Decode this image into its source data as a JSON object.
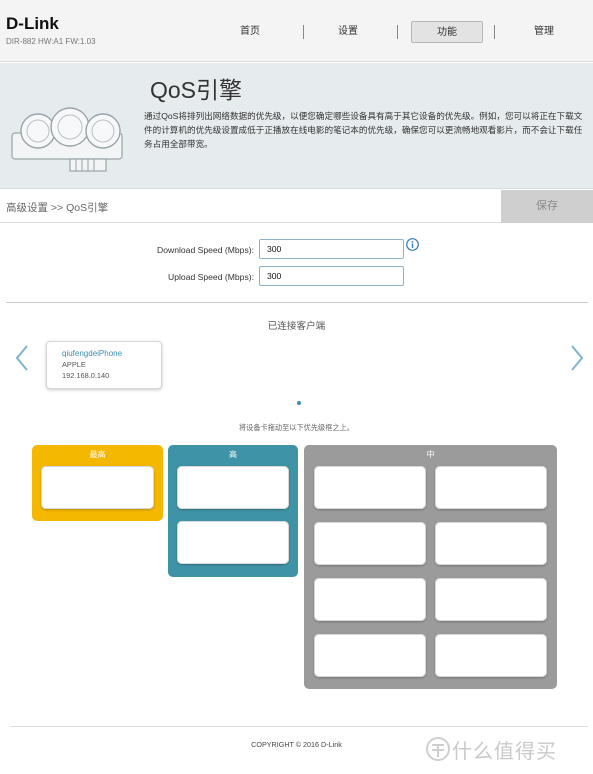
{
  "header": {
    "logo": "D-Link",
    "model_info": "DIR-882 HW:A1 FW:1.03",
    "nav": [
      {
        "label": "首页"
      },
      {
        "label": "设置"
      },
      {
        "label": "功能"
      },
      {
        "label": "管理"
      }
    ],
    "active_nav": "功能"
  },
  "banner": {
    "title": "QoS引擎",
    "description": "通过QoS将排列出网络数据的优先级，以便您确定哪些设备具有高于其它设备的优先级。例如，您可以将正在下载文件的计算机的优先级设置成低于正播放在线电影的笔记本的优先级，确保您可以更流畅地观看影片，而不会让下载任务占用全部带宽。"
  },
  "breadcrumb": {
    "text": "高级设置 >> QoS引擎",
    "save_label": "保存"
  },
  "speed": {
    "download_label": "Download Speed (Mbps):",
    "download_value": "300",
    "upload_label": "Upload Speed (Mbps):",
    "upload_value": "300"
  },
  "clients": {
    "title": "已连接客户端",
    "items": [
      {
        "name": "qiufengdeiPhone",
        "vendor": "APPLE",
        "ip": "192.168.0.140"
      }
    ],
    "drag_hint": "将设备卡拖动至以下优先级框之上。"
  },
  "priorities": [
    {
      "label": "最高",
      "color": "#f5b800"
    },
    {
      "label": "高",
      "color": "#3f93a6"
    },
    {
      "label": "中",
      "color": "#9b9b9b"
    }
  ],
  "footer": {
    "copyright": "COPYRIGHT © 2016 D-Link",
    "watermark": "值 什么值得买"
  },
  "colors": {
    "accent": "#3a8fb0",
    "arrow": "#7fb3cf"
  }
}
